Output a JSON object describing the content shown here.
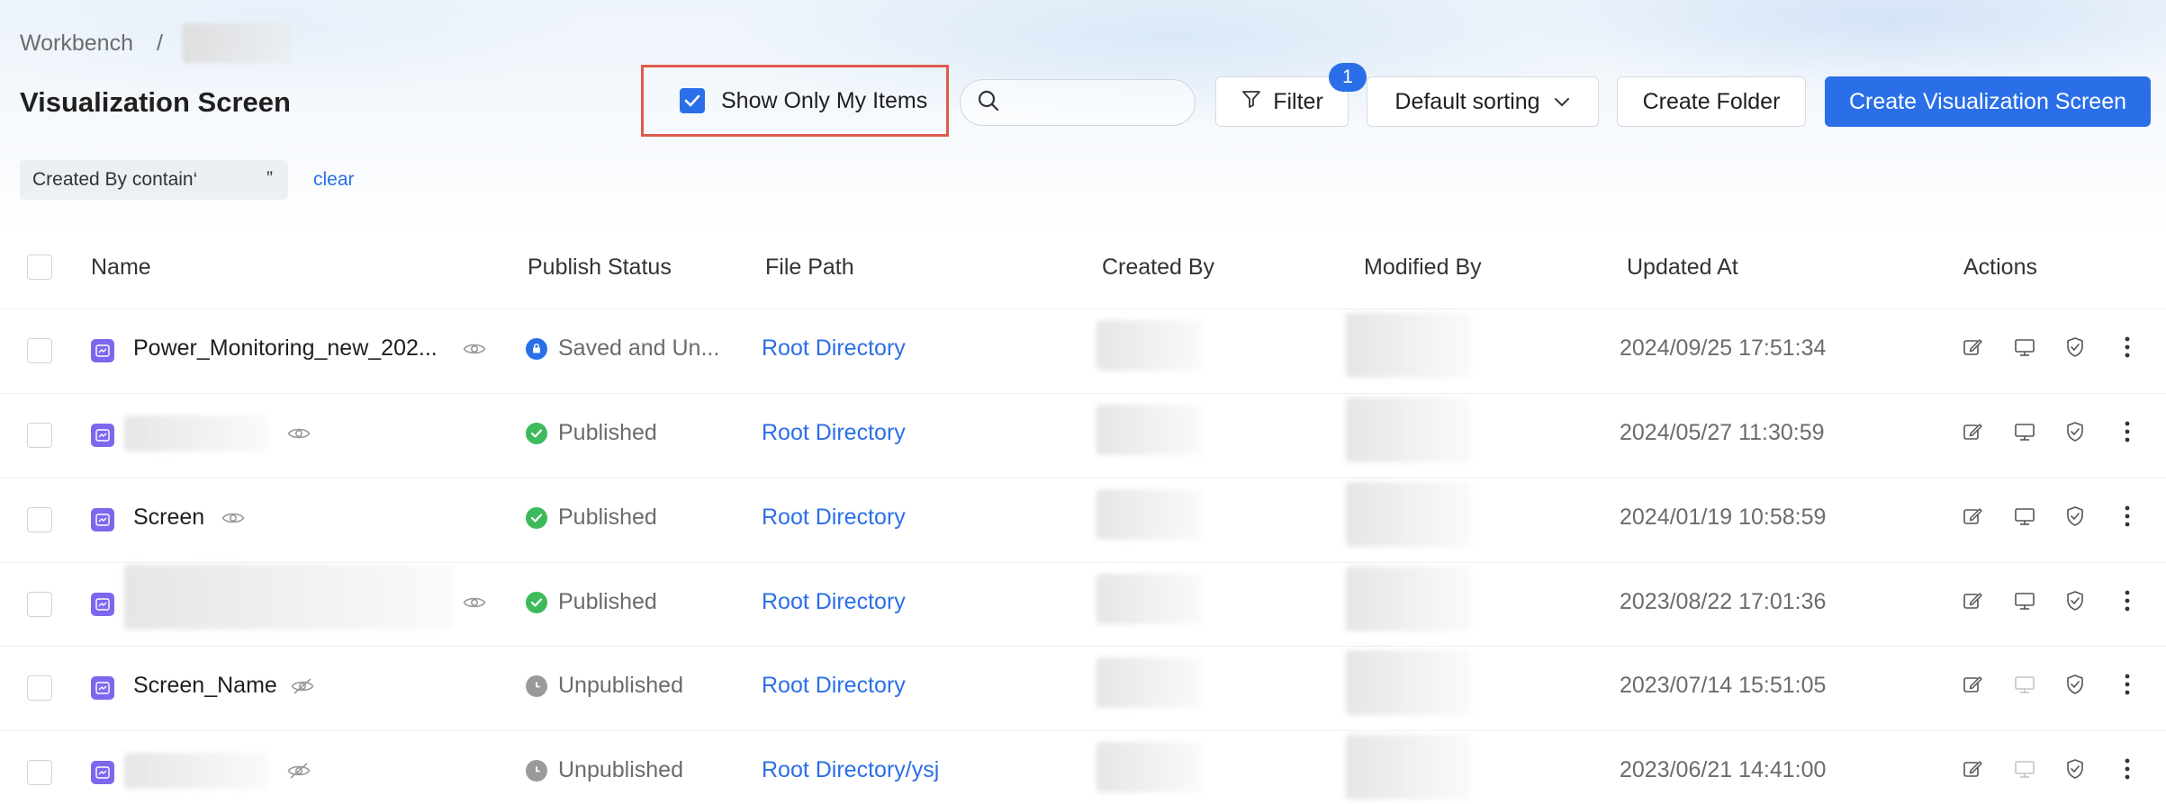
{
  "breadcrumb": {
    "root": "Workbench",
    "separator": "/",
    "current": ""
  },
  "page": {
    "title": "Visualization Screen"
  },
  "toolbar": {
    "show_only_mine_label": "Show Only My Items",
    "show_only_mine_checked": true,
    "search_value": "",
    "filter_label": "Filter",
    "filter_count": "1",
    "sort_label": "Default sorting",
    "create_folder_label": "Create Folder",
    "create_screen_label": "Create Visualization Screen"
  },
  "active_filter": {
    "label": "Created By contain‘",
    "close_quote": "”",
    "clear_label": "clear"
  },
  "table": {
    "headers": {
      "name": "Name",
      "publish_status": "Publish Status",
      "file_path": "File Path",
      "created_by": "Created By",
      "modified_by": "Modified By",
      "updated_at": "Updated At",
      "actions": "Actions"
    },
    "rows": [
      {
        "name": "Power_Monitoring_new_202...",
        "status": "Saved and Un...",
        "status_kind": "saved",
        "path": "Root Directory",
        "updated": "2024/09/25 17:51:34",
        "visible": true
      },
      {
        "name": "",
        "status": "Published",
        "status_kind": "published",
        "path": "Root Directory",
        "updated": "2024/05/27 11:30:59",
        "visible": true
      },
      {
        "name": "Screen",
        "status": "Published",
        "status_kind": "published",
        "path": "Root Directory",
        "updated": "2024/01/19 10:58:59",
        "visible": true
      },
      {
        "name": "",
        "status": "Published",
        "status_kind": "published",
        "path": "Root Directory",
        "updated": "2023/08/22 17:01:36",
        "visible": true
      },
      {
        "name": "Screen_Name",
        "status": "Unpublished",
        "status_kind": "unpublished",
        "path": "Root Directory",
        "updated": "2023/07/14 15:51:05",
        "visible": false
      },
      {
        "name": "",
        "status": "Unpublished",
        "status_kind": "unpublished",
        "path": "Root Directory/ysj",
        "updated": "2023/06/21 14:41:00",
        "visible": false
      }
    ]
  },
  "colors": {
    "primary": "#2a6fe8",
    "published": "#3dba5a",
    "saved": "#2a6fe8",
    "unpublished": "#9a9a9a",
    "highlight_border": "#e05a4b",
    "file_icon": "#7b68ee"
  }
}
